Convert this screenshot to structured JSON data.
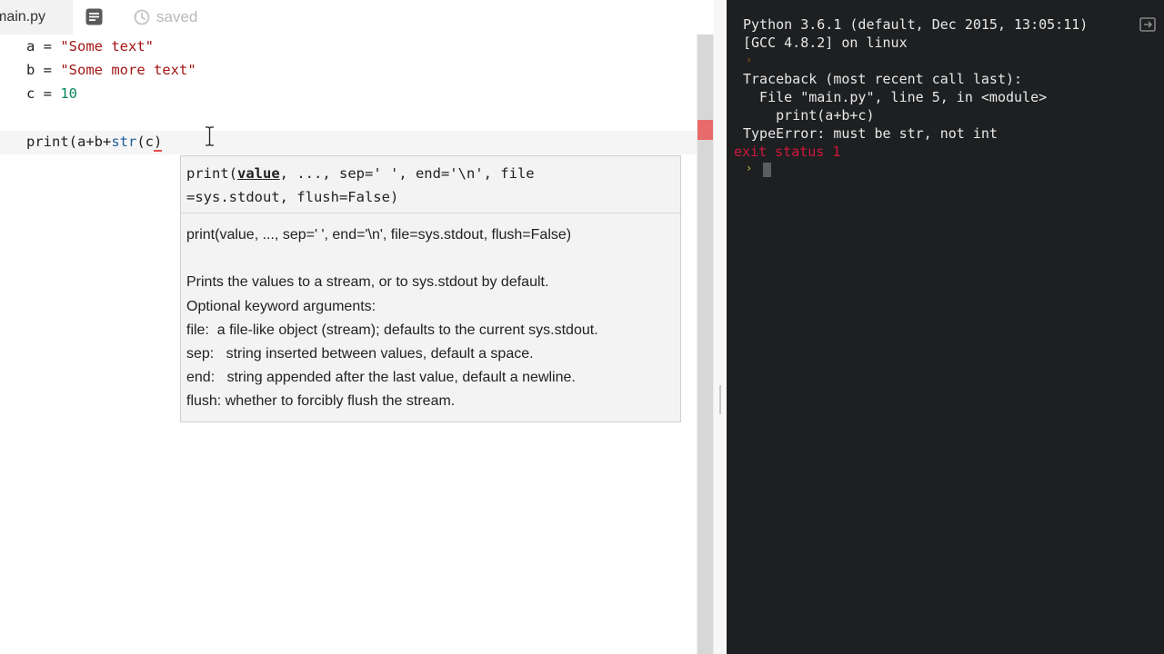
{
  "editor": {
    "file_tab": "main.py",
    "format_icon": "format-icon",
    "saved_icon": "history-icon",
    "saved_label": "saved",
    "code_lines": [
      {
        "var": "a",
        "op": " = ",
        "value": "\"Some text\"",
        "kind": "string"
      },
      {
        "var": "b",
        "op": " = ",
        "value": "\"Some more text\"",
        "kind": "string"
      },
      {
        "var": "c",
        "op": " = ",
        "value": "10",
        "kind": "number"
      },
      {
        "text": ""
      },
      {
        "prefix": "print(a+b+",
        "builtin": "str",
        "open": "(",
        "arg": "c",
        "close": ")"
      }
    ]
  },
  "signature_help": {
    "head_prefix": "print(",
    "head_param": "value",
    "head_rest": ", ..., sep=' ', end='\\n', file\n=sys.stdout, flush=False)",
    "doc_lines": [
      "print(value, ..., sep=' ', end='\\n', file=sys.stdout, flush=False)",
      "",
      "Prints the values to a stream, or to sys.stdout by default.",
      "Optional keyword arguments:",
      "file:  a file-like object (stream); defaults to the current sys.stdout.",
      "sep:   string inserted between values, default a space.",
      "end:   string appended after the last value, default a newline.",
      "flush: whether to forcibly flush the stream."
    ]
  },
  "console": {
    "line1": "Python 3.6.1 (default, Dec 2015, 13:05:11)",
    "line2": "[GCC 4.8.2] on linux",
    "traceback": "Traceback (most recent call last):",
    "file_line": "  File \"main.py\", line 5, in <module>",
    "code_line": "    print(a+b+c)",
    "error": "TypeError: must be str, not int",
    "exit_status": "exit status 1",
    "prompt_glyph": "›",
    "expand_icon": "expand-icon"
  },
  "colors": {
    "console_bg": "#1d1f21",
    "error_red": "#d0173d",
    "prompt_yellow": "#ccc44a",
    "string": "#a31515",
    "number": "#098658"
  }
}
